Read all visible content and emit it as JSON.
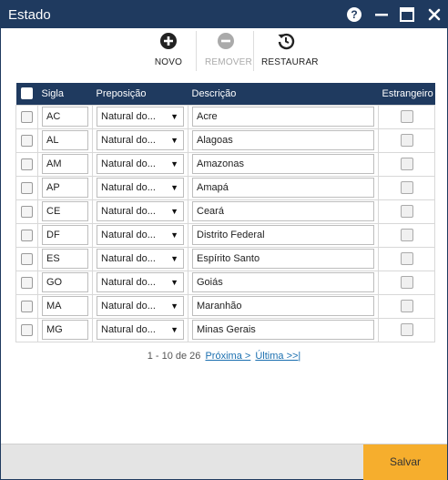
{
  "window": {
    "title": "Estado"
  },
  "titlebar_icons": [
    "help-icon",
    "minimize-icon",
    "maximize-icon",
    "close-icon"
  ],
  "toolbar": {
    "novo_label": "NOVO",
    "remover_label": "REMOVER",
    "restaurar_label": "RESTAURAR"
  },
  "table": {
    "columns": [
      "",
      "Sigla",
      "Preposição",
      "Descrição",
      "Estrangeiro"
    ],
    "rows": [
      {
        "sigla": "AC",
        "preposicao": "Natural do...",
        "descricao": "Acre"
      },
      {
        "sigla": "AL",
        "preposicao": "Natural do...",
        "descricao": "Alagoas"
      },
      {
        "sigla": "AM",
        "preposicao": "Natural do...",
        "descricao": "Amazonas"
      },
      {
        "sigla": "AP",
        "preposicao": "Natural do...",
        "descricao": "Amapá"
      },
      {
        "sigla": "CE",
        "preposicao": "Natural do...",
        "descricao": "Ceará"
      },
      {
        "sigla": "DF",
        "preposicao": "Natural do...",
        "descricao": "Distrito Federal"
      },
      {
        "sigla": "ES",
        "preposicao": "Natural do...",
        "descricao": "Espírito Santo"
      },
      {
        "sigla": "GO",
        "preposicao": "Natural do...",
        "descricao": "Goiás"
      },
      {
        "sigla": "MA",
        "preposicao": "Natural do...",
        "descricao": "Maranhão"
      },
      {
        "sigla": "MG",
        "preposicao": "Natural do...",
        "descricao": "Minas Gerais"
      }
    ]
  },
  "pager": {
    "range_text": "1 - 10 de 26",
    "next_label": "Próxima >",
    "last_label": "Última >>|"
  },
  "footer": {
    "save_label": "Salvar"
  },
  "colors": {
    "titlebar": "#1f3a5f",
    "accent": "#f6ae2d",
    "link": "#1a6fb0"
  }
}
